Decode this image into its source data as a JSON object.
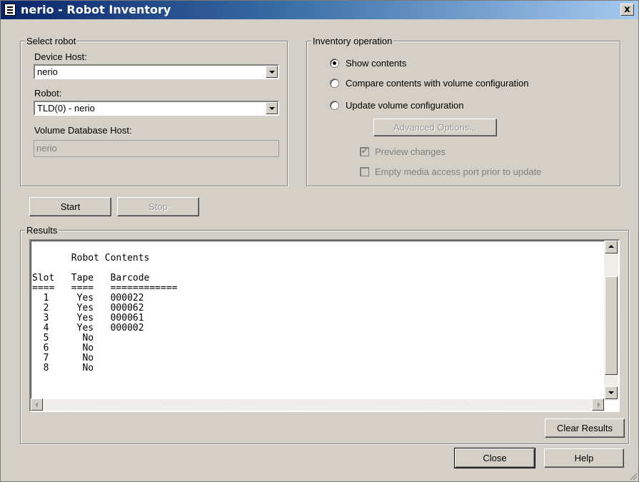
{
  "window": {
    "title": "nerio - Robot Inventory",
    "close_glyph": "x"
  },
  "select_robot": {
    "legend": "Select robot",
    "device_host_label": "Device Host:",
    "device_host_value": "nerio",
    "robot_label": "Robot:",
    "robot_value": "TLD(0) - nerio",
    "volume_db_host_label": "Volume Database Host:",
    "volume_db_host_value": "nerio"
  },
  "inventory_operation": {
    "legend": "Inventory operation",
    "options": [
      {
        "label": "Show contents",
        "selected": true
      },
      {
        "label": "Compare contents with volume configuration",
        "selected": false
      },
      {
        "label": "Update volume configuration",
        "selected": false
      }
    ],
    "advanced_options_label": "Advanced Options...",
    "preview_changes_label": "Preview changes",
    "preview_changes_checked": true,
    "empty_port_label": "Empty media access port prior to update",
    "empty_port_checked": false
  },
  "actions": {
    "start_label": "Start",
    "stop_label": "Stop"
  },
  "results": {
    "legend": "Results",
    "heading": "Robot Contents",
    "columns": [
      "Slot",
      "Tape",
      "Barcode"
    ],
    "rows": [
      {
        "slot": "1",
        "tape": "Yes",
        "barcode": "000022"
      },
      {
        "slot": "2",
        "tape": "Yes",
        "barcode": "000062"
      },
      {
        "slot": "3",
        "tape": "Yes",
        "barcode": "000061"
      },
      {
        "slot": "4",
        "tape": "Yes",
        "barcode": "000002"
      },
      {
        "slot": "5",
        "tape": "No",
        "barcode": ""
      },
      {
        "slot": "6",
        "tape": "No",
        "barcode": ""
      },
      {
        "slot": "7",
        "tape": "No",
        "barcode": ""
      },
      {
        "slot": "8",
        "tape": "No",
        "barcode": ""
      }
    ],
    "clear_results_label": "Clear Results"
  },
  "footer": {
    "close_label": "Close",
    "help_label": "Help"
  }
}
